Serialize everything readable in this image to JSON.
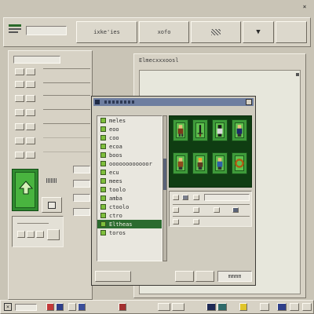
{
  "toolbar": {
    "field_text": "",
    "tab_left": "ixke'ies",
    "tab_mid": "xofo",
    "tab_right_icon": "dither-icon",
    "expand_icon": "chevron-down-icon"
  },
  "right_panel": {
    "header": "Elmecxxxoosl"
  },
  "selected_tile": {
    "icon": "up-arrow-icon"
  },
  "dialog": {
    "list_items": [
      "meles",
      "eoo",
      "coo",
      "ecoa",
      "boos",
      "oooooooooooor",
      "ecu",
      "mees",
      "toolo",
      "amba",
      "ctoolo",
      "ctro",
      "Eltheas",
      "toros"
    ],
    "selected_index": 12,
    "footer_field": "mmmm"
  },
  "colors": {
    "window_bg": "#c9c4b6",
    "accent_green": "#2c6b2f",
    "tile_green": "#3e9b3a"
  }
}
